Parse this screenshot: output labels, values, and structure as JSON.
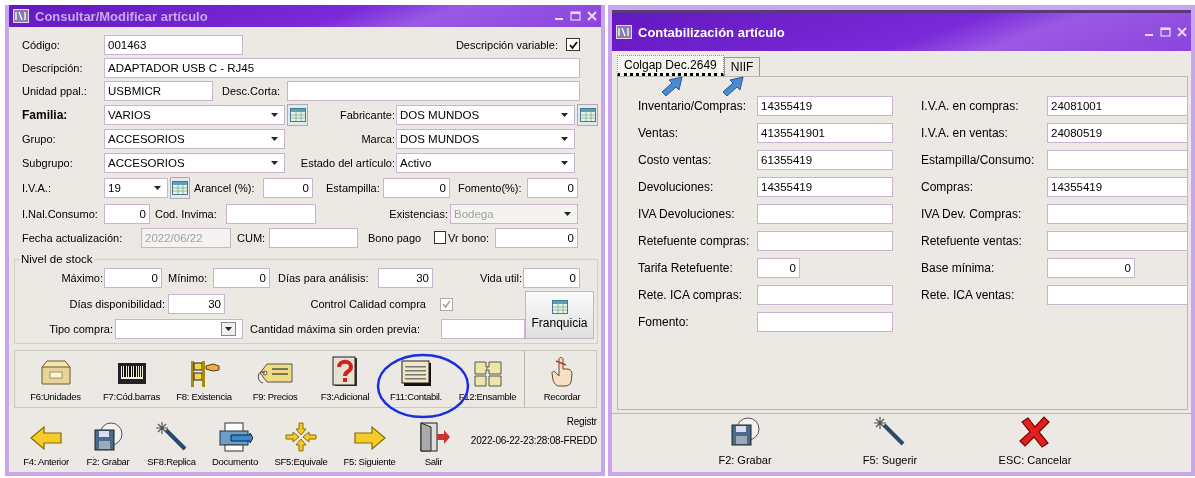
{
  "left_window": {
    "title": "Consultar/Modificar artículo",
    "active": false,
    "rows": [
      {
        "items": [
          {
            "kind": "label",
            "text": "Código:"
          },
          {
            "kind": "input",
            "value": "001463"
          },
          {
            "kind": "label",
            "text": "Descripción variable:"
          },
          {
            "kind": "checkbox",
            "checked": true,
            "disabled": false
          }
        ]
      },
      {
        "items": [
          {
            "kind": "label",
            "text": "Descripción:"
          },
          {
            "kind": "input",
            "value": "ADAPTADOR USB C - RJ45"
          }
        ]
      },
      {
        "items": [
          {
            "kind": "label",
            "text": "Unidad ppal.:"
          },
          {
            "kind": "input",
            "value": "USBMICR"
          },
          {
            "kind": "label",
            "text": "Desc.Corta:"
          },
          {
            "kind": "input"
          }
        ]
      },
      {
        "items": [
          {
            "kind": "label",
            "text": "Familia:",
            "bold": true
          },
          {
            "kind": "select",
            "value": "VARIOS"
          },
          {
            "kind": "lookup"
          },
          {
            "kind": "label",
            "text": "Fabricante:",
            "bold": false
          },
          {
            "kind": "select",
            "value": "DOS MUNDOS"
          },
          {
            "kind": "lookup"
          }
        ]
      },
      {
        "items": [
          {
            "kind": "label",
            "text": "Grupo:"
          },
          {
            "kind": "select",
            "value": "ACCESORIOS"
          },
          {
            "kind": "label",
            "text": "Marca:"
          },
          {
            "kind": "select",
            "value": "DOS MUNDOS"
          }
        ]
      },
      {
        "items": [
          {
            "kind": "label",
            "text": "Subgrupo:"
          },
          {
            "kind": "select",
            "value": "ACCESORIOS"
          },
          {
            "kind": "label",
            "text": "Estado del artículo:"
          },
          {
            "kind": "select",
            "value": "Activo"
          }
        ]
      },
      {
        "items": [
          {
            "kind": "label",
            "text": "I.V.A.:"
          },
          {
            "kind": "select",
            "value": "19"
          },
          {
            "kind": "lookup"
          },
          {
            "kind": "label",
            "text": "Arancel (%):"
          },
          {
            "kind": "number",
            "value": "0"
          },
          {
            "kind": "label",
            "text": "Estampilla:"
          },
          {
            "kind": "number",
            "value": "0"
          },
          {
            "kind": "label",
            "text": "Fomento(%):"
          },
          {
            "kind": "number",
            "value": "0"
          }
        ]
      },
      {
        "items": [
          {
            "kind": "label",
            "text": "I.Nal.Consumo:"
          },
          {
            "kind": "number",
            "value": "0"
          },
          {
            "kind": "label",
            "text": "Cod. Invima:"
          },
          {
            "kind": "input"
          },
          {
            "kind": "label",
            "text": "Existencias:"
          },
          {
            "kind": "select",
            "value": "Bodega",
            "disabled": true
          }
        ]
      },
      {
        "items": [
          {
            "kind": "label",
            "text": "Fecha actualización:"
          },
          {
            "kind": "input",
            "value": "2022/06/22",
            "disabled": true
          },
          {
            "kind": "label",
            "text": "CUM:"
          },
          {
            "kind": "input"
          },
          {
            "kind": "label",
            "text": "Bono pago"
          },
          {
            "kind": "checkbox",
            "checked": false,
            "disabled": false
          },
          {
            "kind": "label",
            "text": "Vr bono:"
          },
          {
            "kind": "number",
            "value": "0"
          }
        ]
      }
    ],
    "stock": {
      "legend": "Nivel de stock",
      "rows": [
        {
          "items": [
            {
              "kind": "label",
              "text": "Máximo:"
            },
            {
              "kind": "number",
              "value": "0"
            },
            {
              "kind": "label",
              "text": "Mínimo:"
            },
            {
              "kind": "number",
              "value": "0"
            },
            {
              "kind": "label",
              "text": "Días para análisis:"
            },
            {
              "kind": "number",
              "value": "30"
            },
            {
              "kind": "label",
              "text": "Vida util:"
            },
            {
              "kind": "number",
              "value": "0"
            }
          ]
        },
        {
          "items": [
            {
              "kind": "label",
              "text": "Días disponibilidad:"
            },
            {
              "kind": "number",
              "value": "30"
            },
            {
              "kind": "label",
              "text": "Control Calidad compra"
            },
            {
              "kind": "checkbox",
              "checked": true,
              "disabled": true
            }
          ]
        },
        {
          "items": [
            {
              "kind": "label",
              "text": "Tipo compra:"
            },
            {
              "kind": "select"
            },
            {
              "kind": "label",
              "text": "Cantidad máxima sin orden previa:"
            },
            {
              "kind": "input"
            }
          ]
        }
      ],
      "button": "Franquicia"
    },
    "toolbar_top": [
      {
        "label": "F6:Unidades"
      },
      {
        "label": "F7:Cód.barras"
      },
      {
        "label": "F8: Existencia"
      },
      {
        "label": "F9: Precios"
      },
      {
        "label": "F3:Adicional"
      },
      {
        "label": "F11:Contabil."
      },
      {
        "label": "F12:Ensamble"
      },
      {
        "label": "Recordar"
      }
    ],
    "toolbar_bottom": [
      {
        "label": "F4: Anterior"
      },
      {
        "label": "F2: Grabar"
      },
      {
        "label": "SF8:Replica"
      },
      {
        "label": "Documento"
      },
      {
        "label": "SF5:Equivale"
      },
      {
        "label": "F5: Siguiente"
      },
      {
        "label": "Salir"
      }
    ],
    "record": [
      "Registr",
      "2022-06-22-23:28:08-FREDD"
    ]
  },
  "right_window": {
    "title": "Contabilización artículo",
    "active": true,
    "tabs": [
      {
        "label": "Colgap Dec.2649",
        "selected": true
      },
      {
        "label": "NIIF",
        "selected": false
      }
    ],
    "left_fields": [
      {
        "label": "Inventario/Compras:",
        "kind": "account",
        "value": "14355419"
      },
      {
        "label": "Ventas:",
        "kind": "account",
        "value": "4135541901"
      },
      {
        "label": "Costo ventas:",
        "kind": "account",
        "value": "61355419"
      },
      {
        "label": "Devoluciones:",
        "kind": "account",
        "value": "14355419"
      },
      {
        "label": "IVA Devoluciones:",
        "kind": "account"
      },
      {
        "label": "Retefuente compras:",
        "kind": "account"
      },
      {
        "label": "Tarifa Retefuente:",
        "kind": "number",
        "value": "0"
      },
      {
        "label": "Rete. ICA compras:",
        "kind": "account"
      },
      {
        "label": "Fomento:",
        "kind": "account"
      }
    ],
    "right_fields": [
      {
        "label": "I.V.A. en compras:",
        "kind": "account",
        "value": "24081001"
      },
      {
        "label": "I.V.A. en ventas:",
        "kind": "account",
        "value": "24080519"
      },
      {
        "label": "Estampilla/Consumo:",
        "kind": "account"
      },
      {
        "label": "Compras:",
        "kind": "account",
        "value": "14355419"
      },
      {
        "label": "IVA Dev. Compras:",
        "kind": "account"
      },
      {
        "label": "Retefuente ventas:",
        "kind": "account"
      },
      {
        "label": "Base mínima:",
        "kind": "number",
        "value": "0"
      },
      {
        "label": "Rete. ICA ventas:",
        "kind": "account"
      }
    ],
    "buttons": [
      {
        "label": "F2: Grabar"
      },
      {
        "label": "F5: Sugerir"
      },
      {
        "label": "ESC: Cancelar"
      }
    ]
  }
}
